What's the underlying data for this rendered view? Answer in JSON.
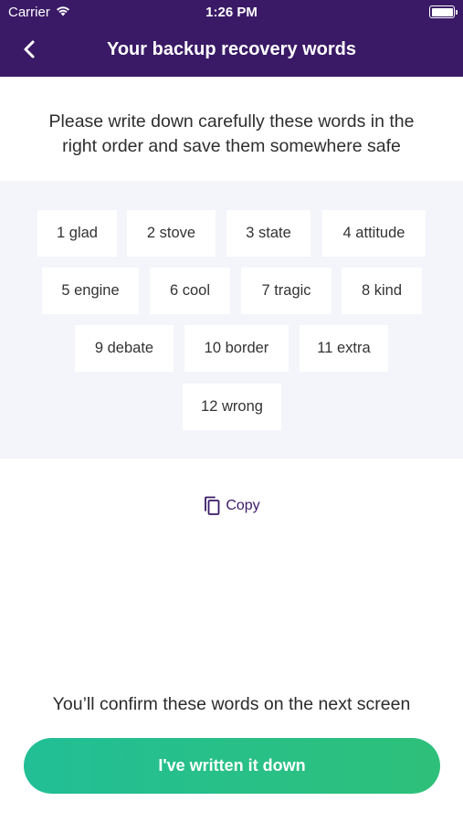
{
  "status_bar": {
    "carrier": "Carrier",
    "time": "1:26 PM",
    "wifi_icon": "wifi-icon",
    "battery_icon": "battery-icon"
  },
  "nav": {
    "back_icon": "chevron-left-icon",
    "title": "Your backup recovery words"
  },
  "instructions": {
    "line1": "Please write down carefully these words in the",
    "line2": "right order and save them somewhere safe"
  },
  "words": [
    "1 glad",
    "2 stove",
    "3 state",
    "4 attitude",
    "5 engine",
    "6 cool",
    "7 tragic",
    "8 kind",
    "9 debate",
    "10 border",
    "11 extra",
    "12 wrong"
  ],
  "copy": {
    "icon": "copy-icon",
    "label": "Copy"
  },
  "confirm_note": "You’ll confirm these words on the next screen",
  "primary_button": {
    "label": "I've written it down"
  },
  "colors": {
    "header": "#3a1a66",
    "panel": "#f4f5fa",
    "accent": "#3a1a66",
    "button_start": "#22bf96",
    "button_end": "#2ec07a"
  }
}
